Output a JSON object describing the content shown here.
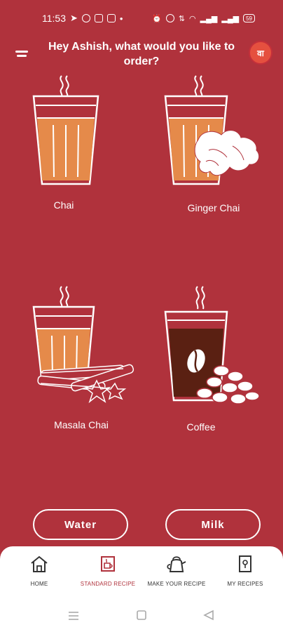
{
  "status_bar": {
    "time": "11:53",
    "battery": "59"
  },
  "header": {
    "greeting": "Hey Ashish, what would you like to order?",
    "avatar_letter": "वा"
  },
  "drinks": [
    {
      "name": "Chai"
    },
    {
      "name": "Ginger Chai"
    },
    {
      "name": "Masala Chai"
    },
    {
      "name": "Coffee"
    }
  ],
  "buttons": {
    "water": "Water",
    "milk": "Milk"
  },
  "nav": [
    {
      "label": "HOME",
      "icon": "house-icon",
      "active": false
    },
    {
      "label": "STANDARD RECIPE",
      "icon": "recipe-cup-icon",
      "active": true
    },
    {
      "label": "MAKE YOUR RECIPE",
      "icon": "kettle-icon",
      "active": false
    },
    {
      "label": "MY RECIPES",
      "icon": "recipe-book-icon",
      "active": false
    }
  ],
  "colors": {
    "background": "#b0323c",
    "tea": "#e58a4a",
    "coffee": "#5a2012",
    "nav_active": "#b0323c"
  }
}
